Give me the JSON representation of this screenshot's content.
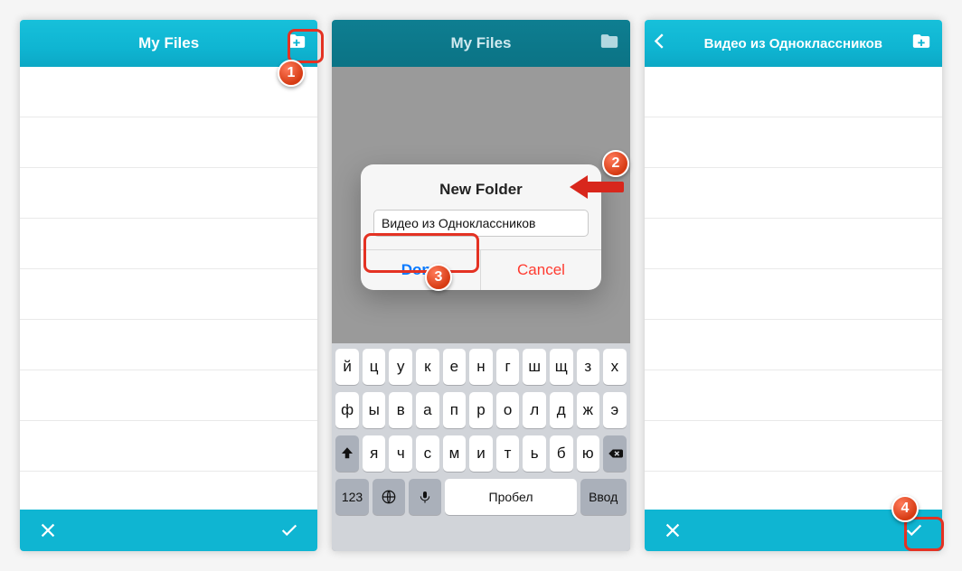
{
  "screens": {
    "left": {
      "header_title": "My Files"
    },
    "middle": {
      "header_title": "My Files",
      "modal_title": "New Folder",
      "folder_value": "Видео из Одноклассников",
      "done_label": "Done",
      "cancel_label": "Cancel"
    },
    "right": {
      "header_title": "Видео из Одноклассников"
    }
  },
  "keyboard": {
    "row1": [
      "й",
      "ц",
      "у",
      "к",
      "е",
      "н",
      "г",
      "ш",
      "щ",
      "з",
      "х"
    ],
    "row2": [
      "ф",
      "ы",
      "в",
      "а",
      "п",
      "р",
      "о",
      "л",
      "д",
      "ж",
      "э"
    ],
    "row3": [
      "я",
      "ч",
      "с",
      "м",
      "и",
      "т",
      "ь",
      "б",
      "ю"
    ],
    "mode_key": "123",
    "space_key": "Пробел",
    "enter_key": "Ввод"
  },
  "callouts": {
    "b1": "1",
    "b2": "2",
    "b3": "3",
    "b4": "4"
  }
}
